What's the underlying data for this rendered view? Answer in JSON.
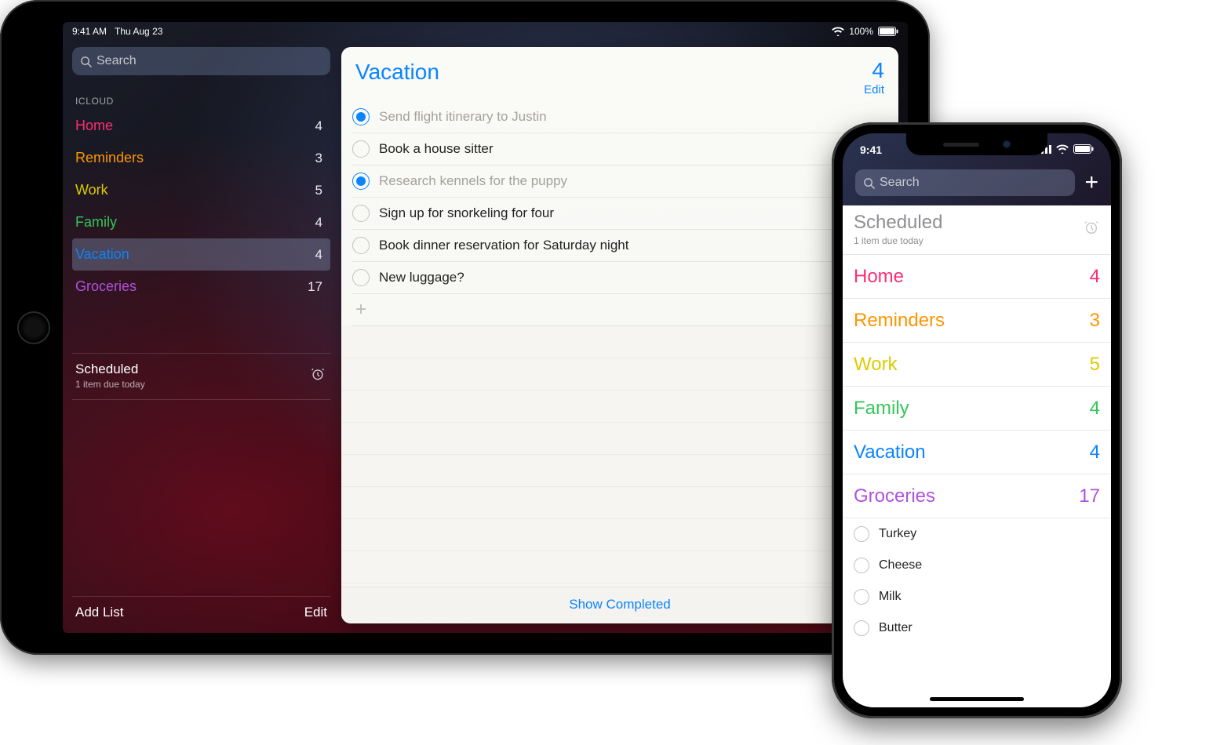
{
  "ipad": {
    "status": {
      "time": "9:41 AM",
      "date": "Thu Aug 23",
      "battery": "100%"
    },
    "search": {
      "placeholder": "Search"
    },
    "section_label": "ICLOUD",
    "lists": [
      {
        "name": "Home",
        "count": 4,
        "color": "c-pink",
        "selected": false
      },
      {
        "name": "Reminders",
        "count": 3,
        "color": "c-orange",
        "selected": false
      },
      {
        "name": "Work",
        "count": 5,
        "color": "c-yellow",
        "selected": false
      },
      {
        "name": "Family",
        "count": 4,
        "color": "c-green",
        "selected": false
      },
      {
        "name": "Vacation",
        "count": 4,
        "color": "c-blue",
        "selected": true
      },
      {
        "name": "Groceries",
        "count": 17,
        "color": "c-purple",
        "selected": false
      }
    ],
    "scheduled": {
      "title": "Scheduled",
      "subtitle": "1 item due today"
    },
    "footer": {
      "add": "Add List",
      "edit": "Edit"
    },
    "detail": {
      "title": "Vacation",
      "count": 4,
      "edit": "Edit",
      "tasks": [
        {
          "label": "Send flight itinerary to Justin",
          "checked": true
        },
        {
          "label": "Book a house sitter",
          "checked": false
        },
        {
          "label": "Research kennels for the puppy",
          "checked": true
        },
        {
          "label": "Sign up for snorkeling for four",
          "checked": false
        },
        {
          "label": "Book dinner reservation for Saturday night",
          "checked": false
        },
        {
          "label": "New luggage?",
          "checked": false
        }
      ],
      "show_completed": "Show Completed"
    }
  },
  "iphone": {
    "status": {
      "time": "9:41"
    },
    "search": {
      "placeholder": "Search"
    },
    "scheduled": {
      "title": "Scheduled",
      "subtitle": "1 item due today"
    },
    "lists": [
      {
        "name": "Home",
        "count": 4,
        "color": "c-pink"
      },
      {
        "name": "Reminders",
        "count": 3,
        "color": "c-orange"
      },
      {
        "name": "Work",
        "count": 5,
        "color": "c-yellow"
      },
      {
        "name": "Family",
        "count": 4,
        "color": "c-green"
      },
      {
        "name": "Vacation",
        "count": 4,
        "color": "c-blue"
      },
      {
        "name": "Groceries",
        "count": 17,
        "color": "c-purple"
      }
    ],
    "groceries": [
      "Turkey",
      "Cheese",
      "Milk",
      "Butter"
    ]
  }
}
